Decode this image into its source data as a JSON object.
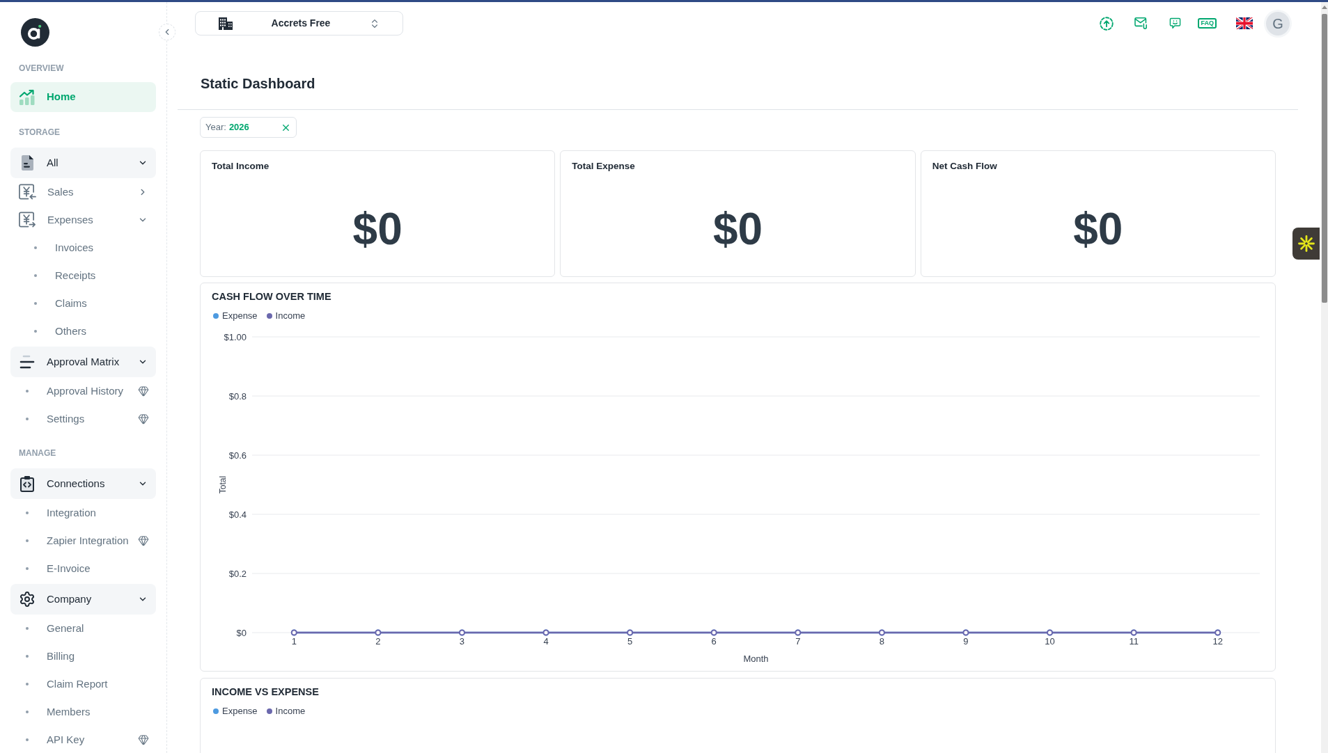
{
  "sidebar": {
    "sections": [
      {
        "label": "OVERVIEW",
        "items": [
          {
            "kind": "link",
            "label": "Home",
            "selected": true
          }
        ]
      },
      {
        "label": "STORAGE",
        "items": [
          {
            "kind": "group",
            "label": "All",
            "selected": false,
            "expanded": true,
            "children": [
              {
                "kind": "menu",
                "label": "Sales",
                "selected": false,
                "expanded": false
              },
              {
                "kind": "menu",
                "label": "Expenses",
                "selected": false,
                "expanded": true,
                "children": [
                  {
                    "kind": "sub",
                    "label": "Invoices",
                    "selected": false,
                    "premium": false
                  },
                  {
                    "kind": "sub",
                    "label": "Receipts",
                    "selected": false,
                    "premium": false
                  },
                  {
                    "kind": "sub",
                    "label": "Claims",
                    "selected": false,
                    "premium": false
                  },
                  {
                    "kind": "sub",
                    "label": "Others",
                    "selected": false,
                    "premium": false
                  }
                ]
              }
            ]
          },
          {
            "kind": "group",
            "label": "Approval Matrix",
            "selected": false,
            "expanded": true,
            "children": [
              {
                "kind": "sub",
                "label": "Approval History",
                "selected": false,
                "premium": true
              },
              {
                "kind": "sub",
                "label": "Settings",
                "selected": false,
                "premium": true
              }
            ]
          }
        ]
      },
      {
        "label": "MANAGE",
        "items": [
          {
            "kind": "group",
            "label": "Connections",
            "selected": false,
            "expanded": true,
            "children": [
              {
                "kind": "sub",
                "label": "Integration",
                "selected": false,
                "premium": false
              },
              {
                "kind": "sub",
                "label": "Zapier Integration",
                "selected": false,
                "premium": true
              },
              {
                "kind": "sub",
                "label": "E-Invoice",
                "selected": false,
                "premium": false
              }
            ]
          },
          {
            "kind": "group",
            "label": "Company",
            "selected": false,
            "expanded": true,
            "children": [
              {
                "kind": "sub",
                "label": "General",
                "selected": false,
                "premium": false
              },
              {
                "kind": "sub",
                "label": "Billing",
                "selected": false,
                "premium": false
              },
              {
                "kind": "sub",
                "label": "Claim Report",
                "selected": false,
                "premium": false
              },
              {
                "kind": "sub",
                "label": "Members",
                "selected": false,
                "premium": false
              },
              {
                "kind": "sub",
                "label": "API Key",
                "selected": false,
                "premium": true
              }
            ]
          }
        ]
      }
    ]
  },
  "header": {
    "company_selector": {
      "label": "Accrets Free"
    },
    "faq_label": "FAQ",
    "avatar": {
      "initial": "G"
    }
  },
  "page": {
    "title": "Static Dashboard",
    "filters": [
      {
        "label": "Year:",
        "value": "2026"
      }
    ],
    "summary_cards": [
      {
        "title": "Total Income",
        "value": "$0"
      },
      {
        "title": "Total Expense",
        "value": "$0"
      },
      {
        "title": "Net Cash Flow",
        "value": "$0"
      }
    ],
    "cash_flow": {
      "chart_data": {
        "type": "line",
        "title": "CASH FLOW OVER TIME",
        "xlabel": "Month",
        "ylabel": "Total",
        "grid": true,
        "x": [
          1,
          2,
          3,
          4,
          5,
          6,
          7,
          8,
          9,
          10,
          11,
          12
        ],
        "series": [
          {
            "name": "Expense",
            "color": "#4d9ae0",
            "marker": true,
            "values": [
              0,
              0,
              0,
              0,
              0,
              0,
              0,
              0,
              0,
              0,
              0,
              0
            ]
          },
          {
            "name": "Income",
            "color": "#6b68ad",
            "marker": true,
            "values": [
              0,
              0,
              0,
              0,
              0,
              0,
              0,
              0,
              0,
              0,
              0,
              0
            ]
          }
        ],
        "ylim": [
          0,
          1
        ],
        "yticks": [
          {
            "value": 0,
            "label": "$0"
          },
          {
            "value": 0.2,
            "label": "$0.2"
          },
          {
            "value": 0.4,
            "label": "$0.4"
          },
          {
            "value": 0.6,
            "label": "$0.6"
          },
          {
            "value": 0.8,
            "label": "$0.8"
          },
          {
            "value": 1,
            "label": "$1.00"
          }
        ]
      }
    },
    "income_vs_expense": {
      "title": "INCOME VS EXPENSE",
      "legend": [
        {
          "name": "Expense",
          "color": "#4d9ae0"
        },
        {
          "name": "Income",
          "color": "#6b68ad"
        }
      ]
    }
  }
}
